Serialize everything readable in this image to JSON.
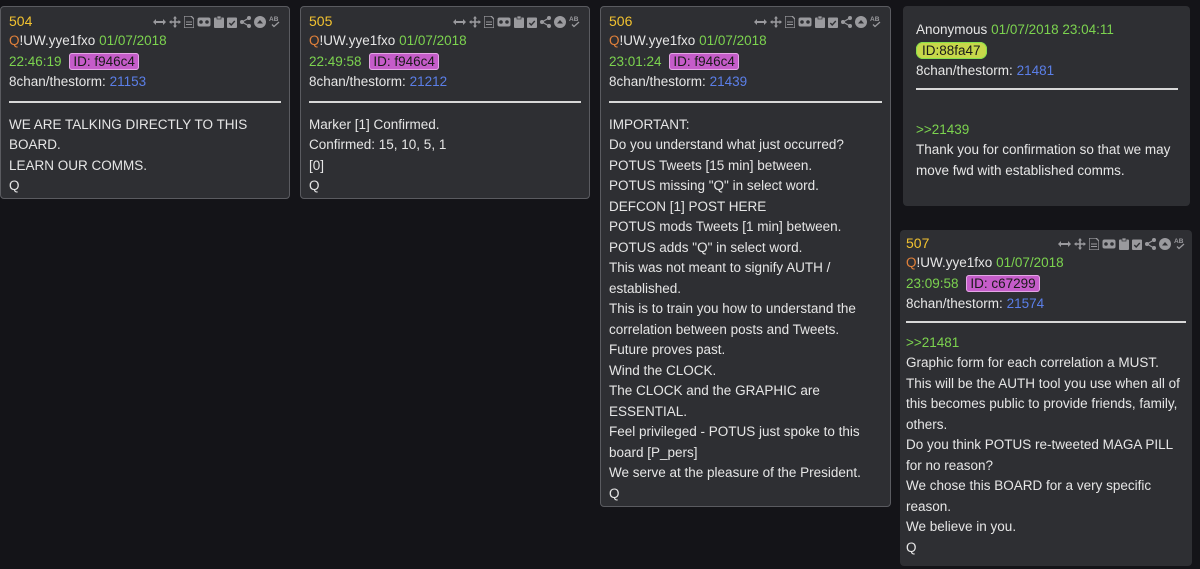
{
  "posts": [
    {
      "num": "504",
      "q": "Q",
      "uid": "!UW.yye1fxo",
      "date": "01/07/2018",
      "time": "22:46:19",
      "id_label": "ID:",
      "id_val": "f946c4",
      "board": "8chan/thestorm:",
      "link": "21153",
      "body": [
        "WE ARE TALKING DIRECTLY TO THIS BOARD.",
        "LEARN OUR COMMS.",
        "Q"
      ]
    },
    {
      "num": "505",
      "q": "Q",
      "uid": "!UW.yye1fxo",
      "date": "01/07/2018",
      "time": "22:49:58",
      "id_label": "ID:",
      "id_val": "f946c4",
      "board": "8chan/thestorm:",
      "link": "21212",
      "body": [
        "Marker [1] Confirmed.",
        "Confirmed: 15, 10, 5, 1",
        "[0]",
        "Q"
      ]
    },
    {
      "num": "506",
      "q": "Q",
      "uid": "!UW.yye1fxo",
      "date": "01/07/2018",
      "time": "23:01:24",
      "id_label": "ID:",
      "id_val": "f946c4",
      "board": "8chan/thestorm:",
      "link": "21439",
      "body": [
        "IMPORTANT:",
        "Do you understand what just occurred?",
        "POTUS Tweets [15 min] between.",
        "POTUS missing \"Q\" in select word.",
        "DEFCON [1] POST HERE",
        "POTUS mods Tweets [1 min] between.",
        "POTUS adds \"Q\" in select word.",
        "This was not meant to signify AUTH / established.",
        "This is to train you how to understand the correlation between posts and Tweets.",
        "Future proves past.",
        "Wind the CLOCK.",
        "The CLOCK and the GRAPHIC are ESSENTIAL.",
        "Feel privileged - POTUS just spoke to this board [P_pers]",
        "We serve at the pleasure of the President.",
        "Q"
      ]
    },
    {
      "num": "507",
      "q": "Q",
      "uid": "!UW.yye1fxo",
      "date": "01/07/2018",
      "time": "23:09:58",
      "id_label": "ID:",
      "id_val": "c67299",
      "board": "8chan/thestorm:",
      "link": "21574",
      "ref": ">>21481",
      "body": [
        "Graphic form for each correlation a MUST.",
        "This will be the AUTH tool you use when all of this becomes public to provide friends, family, others.",
        "Do you think POTUS re-tweeted MAGA PILL for no reason?",
        "We chose this BOARD for a very specific reason.",
        "We believe in you.",
        "Q"
      ]
    }
  ],
  "anon": {
    "name": "Anonymous",
    "datetime": "01/07/2018 23:04:11",
    "id_label": "ID:",
    "id_val": "88fa47",
    "board": "8chan/thestorm:",
    "link": "21481",
    "ref": ">>21439",
    "body": "Thank you for confirmation so that we may move fwd with established comms."
  },
  "icons": [
    "expand-arrows-icon",
    "move-icon",
    "document-icon",
    "vr-goggles-icon",
    "clipboard-icon",
    "clipboard-check-icon",
    "share-icon",
    "up-circle-icon",
    "spellcheck-icon"
  ],
  "colors": {
    "post_number": "#f2c230",
    "trip": "#7cd34f",
    "link": "#5b7fe8",
    "id_badge": "#c55cc9",
    "q": "#e0803a"
  }
}
